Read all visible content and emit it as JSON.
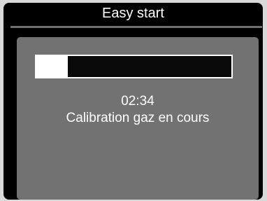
{
  "header": {
    "title": "Easy start"
  },
  "progress": {
    "fraction": 0.16
  },
  "calibration": {
    "timer": "02:34",
    "status": "Calibration gaz en cours"
  },
  "colors": {
    "screen_background": "#000000",
    "panel_background": "#727272",
    "divider": "#6f6f6f",
    "text": "#ffffff"
  }
}
